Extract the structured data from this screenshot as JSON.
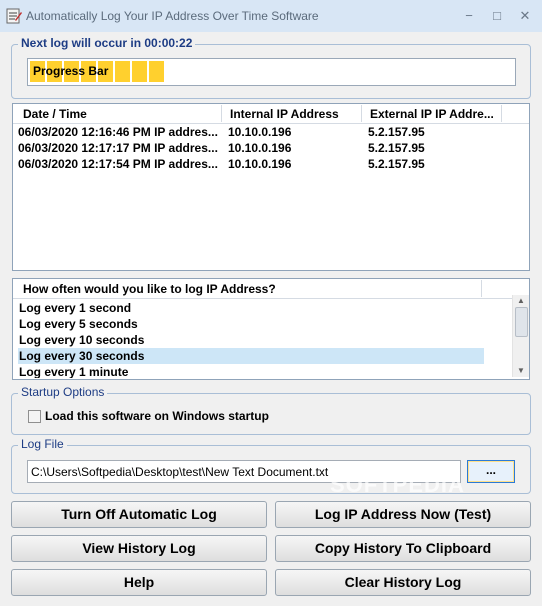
{
  "window": {
    "title": "Automatically Log Your IP Address Over Time Software",
    "controls": {
      "minimize": "−",
      "maximize": "□",
      "close": "✕"
    }
  },
  "next_log": {
    "label": "Next log will occur in 00:00:22",
    "progress_label": "Progress Bar",
    "progress_fraction": 0.28
  },
  "log_table": {
    "columns": [
      "Date / Time",
      "Internal IP Address",
      "External IP IP Addre..."
    ],
    "rows": [
      [
        "06/03/2020 12:16:46 PM IP addres...",
        "10.10.0.196",
        "5.2.157.95"
      ],
      [
        "06/03/2020 12:17:17 PM IP addres...",
        "10.10.0.196",
        "5.2.157.95"
      ],
      [
        "06/03/2020 12:17:54 PM IP addres...",
        "10.10.0.196",
        "5.2.157.95"
      ]
    ]
  },
  "frequency": {
    "header": "How often would you like to log IP Address?",
    "options": [
      "Log every 1 second",
      "Log every 5 seconds",
      "Log every 10 seconds",
      "Log every 30 seconds",
      "Log every 1 minute"
    ],
    "selected_index": 3
  },
  "startup": {
    "legend": "Startup Options",
    "checkbox_label": "Load this software on Windows startup",
    "checked": false
  },
  "log_file": {
    "legend": "Log File",
    "path": "C:\\Users\\Softpedia\\Desktop\\test\\New Text Document.txt",
    "browse_label": "..."
  },
  "buttons": {
    "turn_off": "Turn Off Automatic Log",
    "log_now": "Log IP Address Now (Test)",
    "view_history": "View History Log",
    "copy_history": "Copy History To Clipboard",
    "help": "Help",
    "clear_history": "Clear History Log"
  },
  "watermark": "SOFTPEDIA",
  "colors": {
    "accent": "#1d3c84",
    "progress": "#ffd02e",
    "selection": "#cde6f7"
  }
}
